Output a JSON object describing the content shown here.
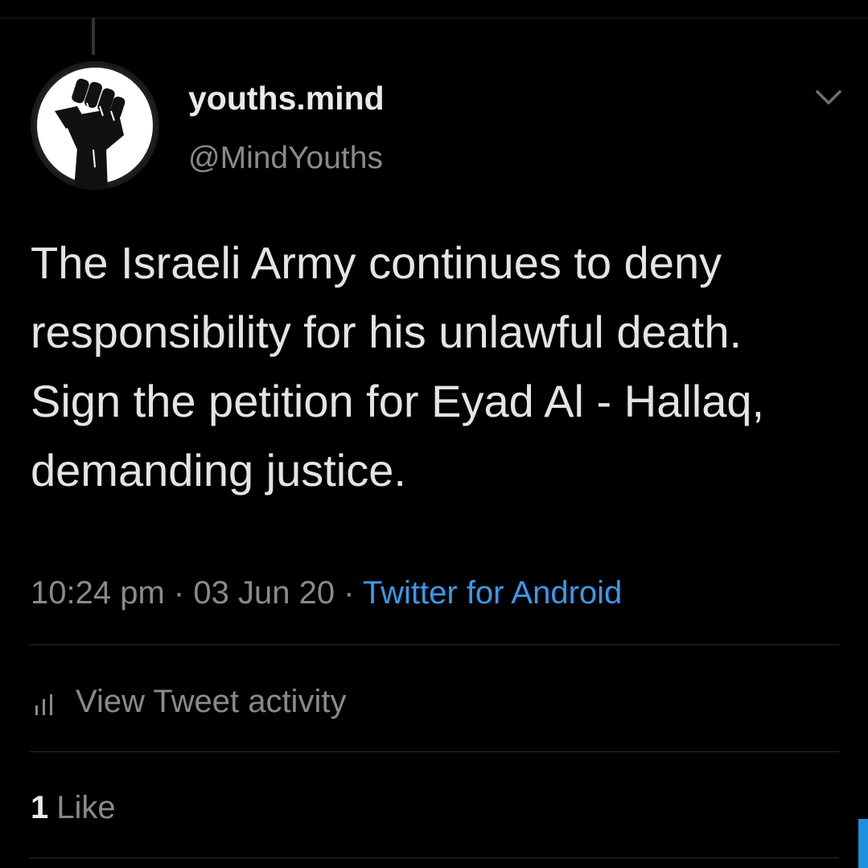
{
  "colors": {
    "background": "#000000",
    "primary_text": "#e4e4e4",
    "secondary_text": "#8a8a8a",
    "link": "#3a9ae8",
    "divider": "#2a2a2a",
    "accent": "#1d8fe0"
  },
  "icons": {
    "avatar": "raised-fist-icon",
    "menu": "chevron-down-icon",
    "activity": "bar-chart-icon"
  },
  "author": {
    "display_name": "youths.mind",
    "handle": "@MindYouths"
  },
  "tweet": {
    "text": "The Israeli Army continues to deny responsibility for his unlawful death.\nSign the petition for Eyad Al - Hallaq, demanding justice.",
    "time": "10:24 pm",
    "separator": "·",
    "date": "03 Jun 20",
    "source": "Twitter for Android"
  },
  "activity": {
    "label": "View Tweet activity"
  },
  "stats": {
    "likes_count": "1",
    "likes_label": "Like"
  }
}
